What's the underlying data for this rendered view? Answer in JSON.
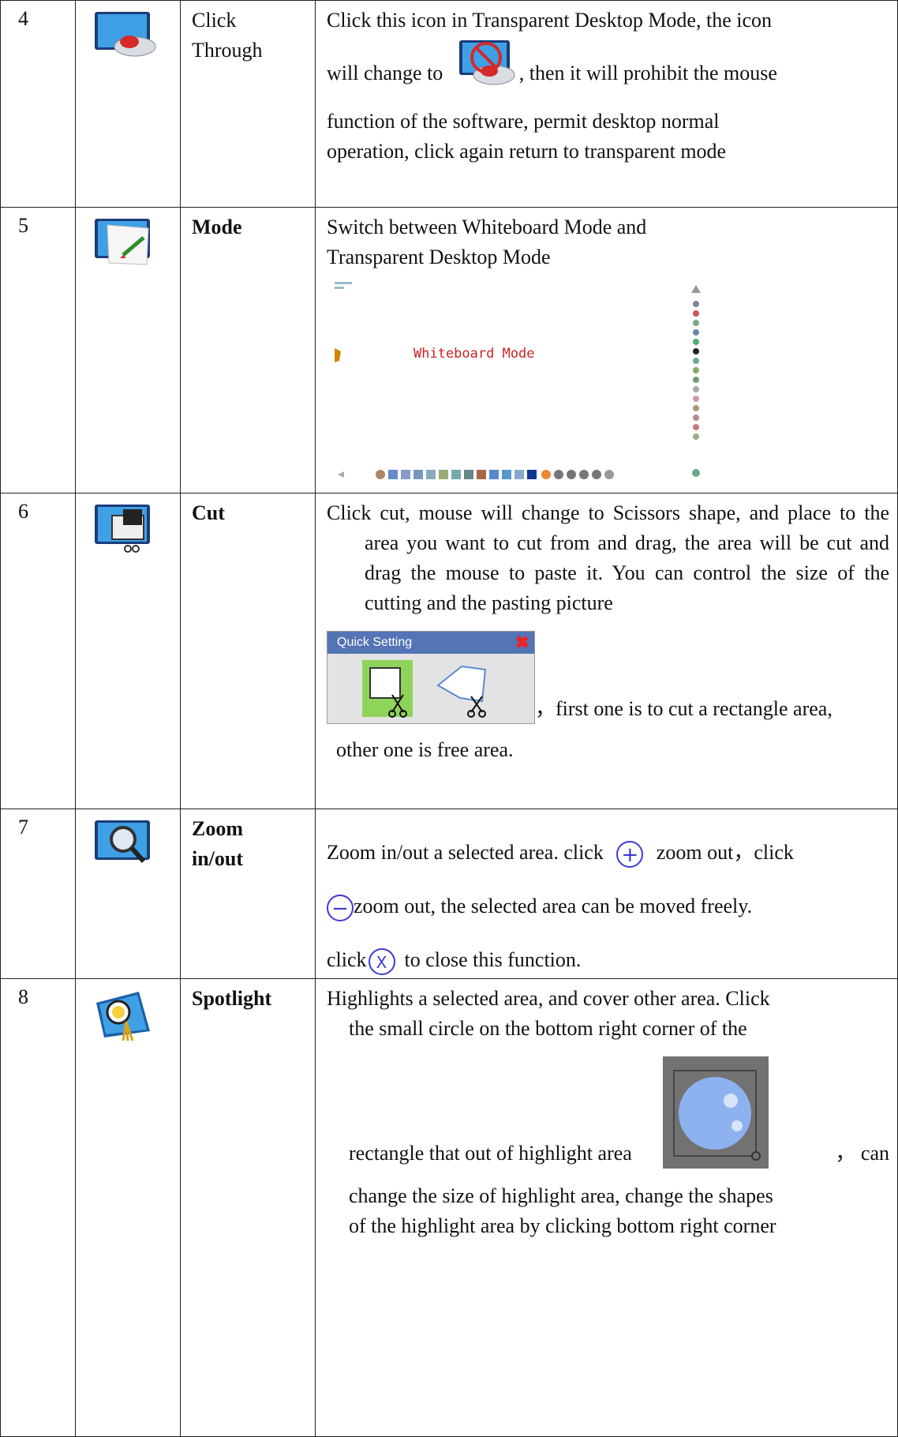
{
  "rows": [
    {
      "num": "4",
      "name": "Click Through",
      "desc_line1": "Click this icon in Transparent Desktop Mode, the icon",
      "desc_line2a": "will change to",
      "desc_line2b": ", then it will prohibit the mouse",
      "desc_line3": "function of the software, permit desktop normal",
      "desc_line4": "operation, click again return to transparent mode"
    },
    {
      "num": "5",
      "name": "Mode",
      "desc_line1": "Switch between Whiteboard Mode and",
      "desc_line2": "Transparent Desktop Mode",
      "screenshot_label": "Whiteboard Mode"
    },
    {
      "num": "6",
      "name": "Cut",
      "desc": "Click cut, mouse will change to Scissors shape, and place to the area you want to cut from and drag, the area will be cut and drag the mouse to paste it. You can control the size of the cutting and the pasting picture",
      "quick_setting_title": "Quick Setting",
      "quick_setting_close": "✖",
      "after_image": "，first one is to cut a rectangle area,",
      "last_line": "other one is free area."
    },
    {
      "num": "7",
      "name_line1": "Zoom",
      "name_line2": "in/out",
      "line1a": "Zoom in/out a selected area. click",
      "line1b": "zoom out，click",
      "plus_symbol": "+",
      "minus_symbol": "−",
      "line2": "zoom out, the selected area can be moved freely.",
      "line3a": "click",
      "close_symbol": "X",
      "line3b": "to close this function."
    },
    {
      "num": "8",
      "name": "Spotlight",
      "line1": "Highlights a selected area, and cover other area. Click",
      "line2": "the small circle on the bottom right corner of the",
      "line3a": "rectangle that out of highlight area",
      "line3b": "，  can",
      "line4": "change the size of highlight area, change the shapes",
      "line5": "of the highlight area by clicking bottom right corner"
    }
  ]
}
